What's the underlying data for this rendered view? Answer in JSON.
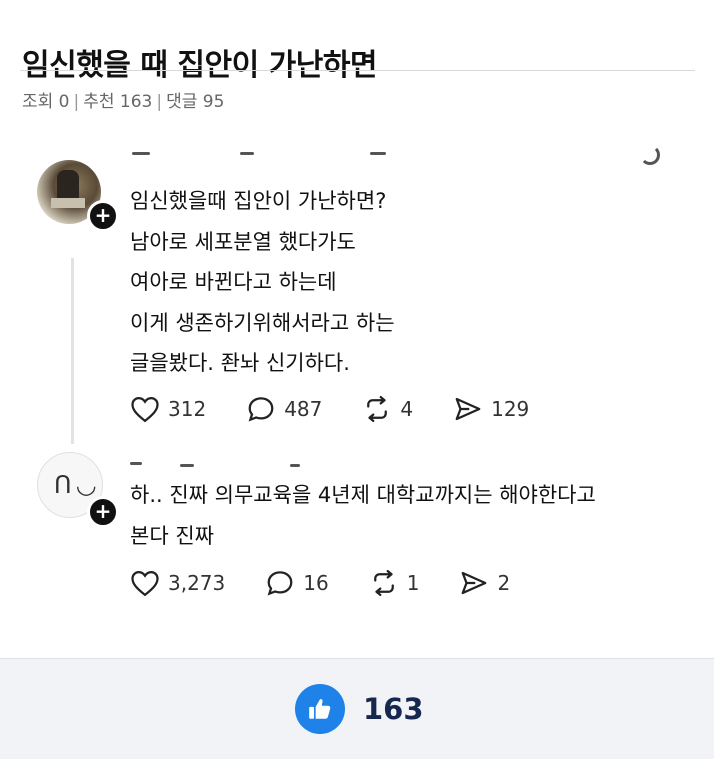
{
  "post": {
    "title": "임신했을 때 집안이 가난하면",
    "meta": {
      "views_label": "조회 0",
      "recommend_label": "추천 163",
      "comments_label": "댓글 95",
      "separator": "|"
    }
  },
  "thread": {
    "posts": [
      {
        "lines": [
          "임신했을때 집안이 가난하면?",
          "남아로 세포분열 했다가도",
          "여아로 바뀐다고 하는데",
          "이게 생존하기위해서라고 하는",
          "글을봤다. 좐놔 신기하다."
        ],
        "likes": "312",
        "replies": "487",
        "reposts": "4",
        "shares": "129",
        "follow_symbol": "+"
      },
      {
        "lines": [
          "하.. 진짜 의무교육을 4년제 대학교까지는 해야한다고",
          "본다 진짜"
        ],
        "likes": "3,273",
        "replies": "16",
        "reposts": "1",
        "shares": "2",
        "follow_symbol": "+"
      }
    ]
  },
  "footer": {
    "like_count": "163"
  },
  "colors": {
    "like_button": "#1e82e8",
    "like_count": "#16284d",
    "footer_bg": "#f2f3f7"
  }
}
